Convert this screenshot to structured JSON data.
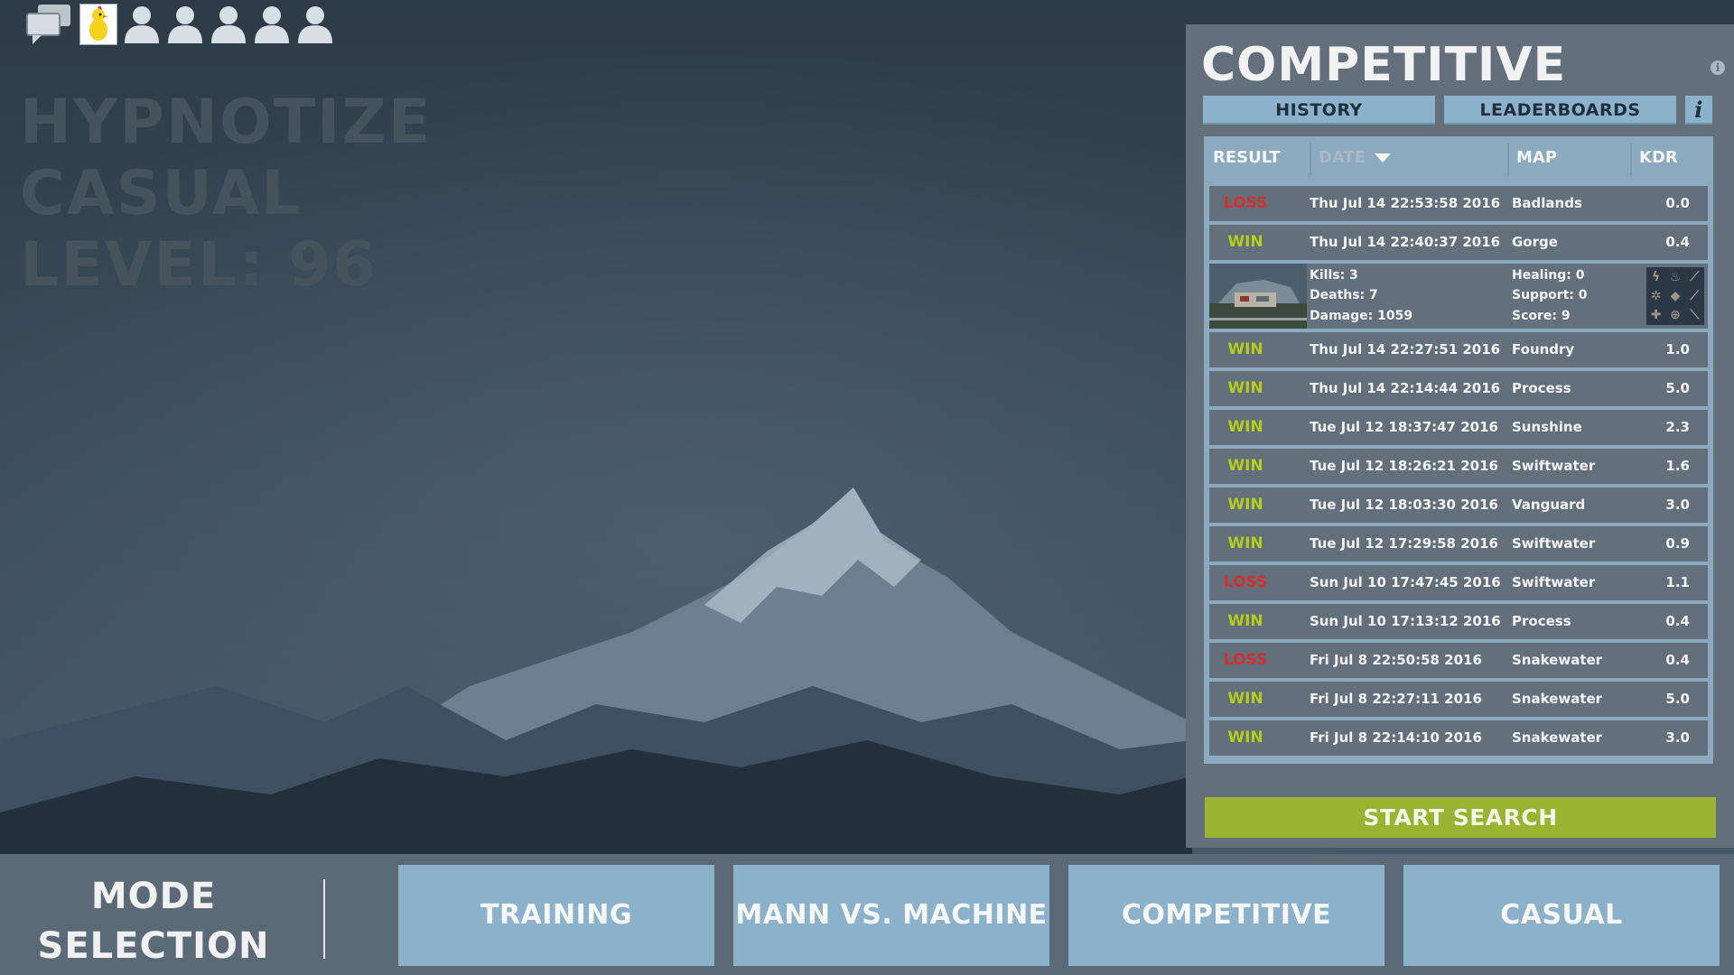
{
  "social": {
    "icons": [
      "chat-icon",
      "player-avatar",
      "friend-icon",
      "friend-icon",
      "friend-icon",
      "friend-icon",
      "friend-icon"
    ]
  },
  "player": {
    "name": "HYPNOTIZE",
    "mode": "CASUAL",
    "level": "LEVEL: 96"
  },
  "panel": {
    "title": "COMPETITIVE",
    "info_glyph": "i",
    "tabs": {
      "history": "HISTORY",
      "leaderboards": "LEADERBOARDS",
      "info": "i"
    },
    "columns": {
      "result": "RESULT",
      "date": "DATE",
      "map": "MAP",
      "kdr": "KDR"
    },
    "matches": [
      {
        "result": "LOSS",
        "date": "Thu Jul 14 22:53:58 2016",
        "map": "Badlands",
        "kdr": "0.0"
      },
      {
        "result": "WIN",
        "date": "Thu Jul 14 22:40:37 2016",
        "map": "Gorge",
        "kdr": "0.4"
      },
      {
        "result": "WIN",
        "date": "Thu Jul 14 22:27:51 2016",
        "map": "Foundry",
        "kdr": "1.0"
      },
      {
        "result": "WIN",
        "date": "Thu Jul 14 22:14:44 2016",
        "map": "Process",
        "kdr": "5.0"
      },
      {
        "result": "WIN",
        "date": "Tue Jul 12 18:37:47 2016",
        "map": "Sunshine",
        "kdr": "2.3"
      },
      {
        "result": "WIN",
        "date": "Tue Jul 12 18:26:21 2016",
        "map": "Swiftwater",
        "kdr": "1.6"
      },
      {
        "result": "WIN",
        "date": "Tue Jul 12 18:03:30 2016",
        "map": "Vanguard",
        "kdr": "3.0"
      },
      {
        "result": "WIN",
        "date": "Tue Jul 12 17:29:58 2016",
        "map": "Swiftwater",
        "kdr": "0.9"
      },
      {
        "result": "LOSS",
        "date": "Sun Jul 10 17:47:45 2016",
        "map": "Swiftwater",
        "kdr": "1.1"
      },
      {
        "result": "WIN",
        "date": "Sun Jul 10 17:13:12 2016",
        "map": "Process",
        "kdr": "0.4"
      },
      {
        "result": "LOSS",
        "date": "Fri Jul  8 22:50:58 2016",
        "map": "Snakewater",
        "kdr": "0.4"
      },
      {
        "result": "WIN",
        "date": "Fri Jul  8 22:27:11 2016",
        "map": "Snakewater",
        "kdr": "5.0"
      },
      {
        "result": "WIN",
        "date": "Fri Jul  8 22:14:10 2016",
        "map": "Snakewater",
        "kdr": "3.0"
      }
    ],
    "detail": {
      "kills": "Kills: 3",
      "deaths": "Deaths: 7",
      "damage": "Damage: 1059",
      "healing": "Healing: 0",
      "support": "Support: 0",
      "score": "Score: 9",
      "medals": [
        "lightning-medal-icon",
        "flame-medal-icon",
        "knife-medal-icon",
        "gear-medal-icon",
        "shield-medal-icon",
        "sword-medal-icon",
        "cross-medal-icon",
        "crosshair-medal-icon",
        "blade-medal-icon"
      ]
    },
    "start_search": "START SEARCH"
  },
  "bottom": {
    "mode_line1": "MODE",
    "mode_line2": "SELECTION",
    "buttons": [
      "TRAINING",
      "MANN VS. MACHINE",
      "COMPETITIVE",
      "CASUAL"
    ]
  },
  "colors": {
    "win": "#b6cc1c",
    "loss": "#d32f2f",
    "accent_blue": "#8cb2cb",
    "start_green": "#9bb330"
  }
}
